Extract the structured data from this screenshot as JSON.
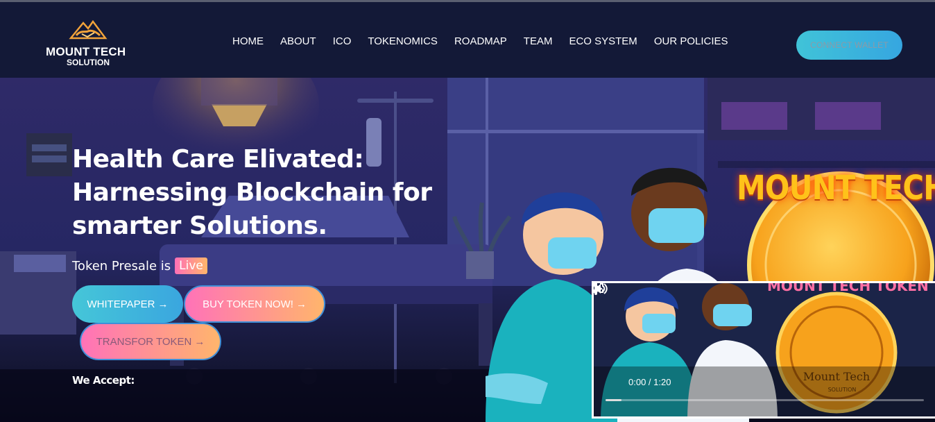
{
  "header": {
    "logo_line1": "MOUNT TECH",
    "logo_line2": "SOLUTION",
    "nav": [
      "HOME",
      "ABOUT",
      "ICO",
      "TOKENOMICS",
      "ROADMAP",
      "TEAM",
      "ECO SYSTEM",
      "OUR POLICIES"
    ],
    "connect_label": "CONNECT WALLET"
  },
  "hero": {
    "headline_line1": "Health Care Elivated:",
    "headline_line2": "Harnessing Blockchain for",
    "headline_line3": "smarter Solutions.",
    "presale_text": "Token Presale is",
    "presale_badge": "Live",
    "whitepaper_label": "WHITEPAPER",
    "buy_label": "BUY TOKEN NOW!",
    "transfer_label": "TRANSFOR TOKEN",
    "arrow": "→",
    "accept_label": "We Accept:",
    "token_title": "MOUNT TECH TOKEN"
  },
  "video": {
    "overlay_title": "MOUNT TECH TOKEN",
    "coin_text_1": "Mount Tech",
    "coin_text_2": "SOLUTION",
    "time": "0:00 / 1:20",
    "progress": 0.05
  },
  "colors": {
    "header_bg": "#131937",
    "accent_cyan": "#40c3d8",
    "accent_pink": "#ff72b8",
    "accent_orange": "#ffb56c",
    "token_gold": "#ffc21a"
  }
}
